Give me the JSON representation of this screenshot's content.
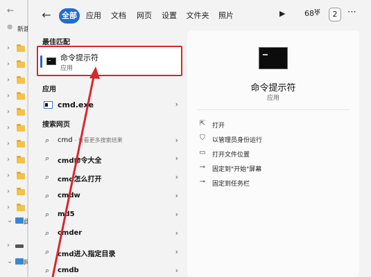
{
  "background": {
    "items": [
      {
        "label": "新建",
        "type": "new"
      },
      {
        "type": "folder"
      },
      {
        "type": "folder"
      },
      {
        "type": "folder"
      },
      {
        "type": "folder"
      },
      {
        "type": "folder"
      },
      {
        "type": "folder"
      },
      {
        "type": "folder"
      },
      {
        "type": "folder"
      },
      {
        "type": "folder"
      },
      {
        "type": "folder"
      },
      {
        "type": "folder"
      },
      {
        "label": "此",
        "type": "pc"
      },
      {
        "type": "drive"
      },
      {
        "label": "网",
        "type": "network"
      }
    ]
  },
  "header": {
    "tabs": [
      {
        "label": "全部",
        "active": true
      },
      {
        "label": "应用"
      },
      {
        "label": "文档"
      },
      {
        "label": "网页"
      },
      {
        "label": "设置"
      },
      {
        "label": "文件夹"
      },
      {
        "label": "照片"
      }
    ],
    "play_icon": "play-icon",
    "points": "68",
    "trophy_icon": "trophy-icon",
    "badge": "2",
    "more": "⋯"
  },
  "results": {
    "best_match_heading": "最佳匹配",
    "best_match": {
      "title": "命令提示符",
      "subtitle": "应用"
    },
    "apps_heading": "应用",
    "app_item": "cmd.exe",
    "web_heading": "搜索网页",
    "web_items": [
      {
        "bold": "cmd",
        "rest": "",
        "sub": " - 查看更多搜索结果"
      },
      {
        "bold": "cmd命令大全",
        "rest": "",
        "sub": ""
      },
      {
        "bold": "cmd怎么打开",
        "rest": "",
        "sub": ""
      },
      {
        "bold": "cmdw",
        "rest": "",
        "sub": ""
      },
      {
        "bold": "md5",
        "rest": "",
        "sub": ""
      },
      {
        "bold": "cmder",
        "rest": "",
        "sub": ""
      },
      {
        "bold": "cmd进入指定目录",
        "rest": "",
        "sub": ""
      },
      {
        "bold": "cmdb",
        "rest": "",
        "sub": ""
      }
    ]
  },
  "preview": {
    "title": "命令提示符",
    "subtitle": "应用",
    "actions": [
      {
        "label": "打开",
        "icon": "open-icon"
      },
      {
        "label": "以管理员身份运行",
        "icon": "shield-icon"
      },
      {
        "label": "打开文件位置",
        "icon": "folder-icon"
      },
      {
        "label": "固定到\"开始\"屏幕",
        "icon": "pin-icon"
      },
      {
        "label": "固定到任务栏",
        "icon": "pin-icon"
      }
    ]
  },
  "annotation": {
    "color": "#d9262c"
  }
}
